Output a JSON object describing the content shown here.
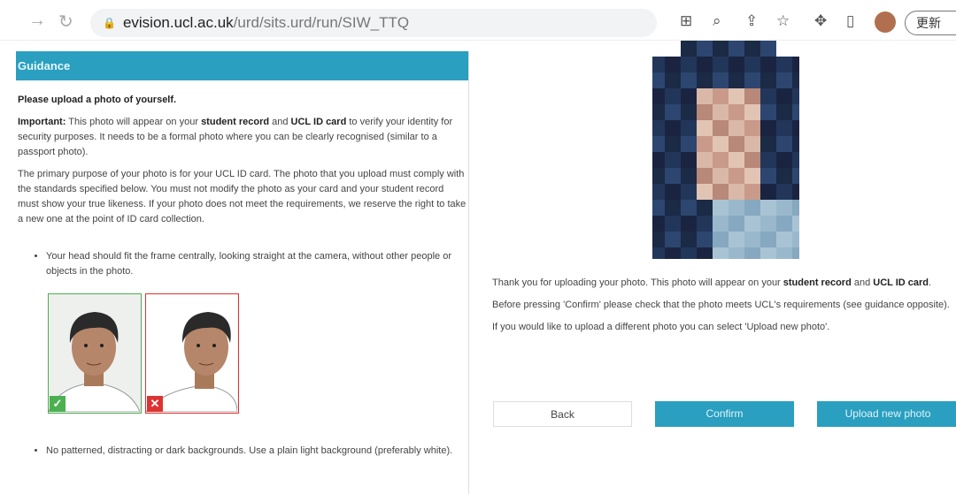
{
  "browser": {
    "url_domain": "evision.ucl.ac.uk",
    "url_path": "/urd/sits.urd/run/SIW_TTQ",
    "update_label": "更新"
  },
  "guidance": {
    "title": "Guidance",
    "intro": "Please upload a photo of yourself.",
    "important_label": "Important:",
    "p1_a": " This photo will appear on your ",
    "p1_b": "student record",
    "p1_c": " and ",
    "p1_d": "UCL ID card",
    "p1_e": " to verify your identity for security purposes. It needs to be a formal photo where you can be clearly recognised (similar to a passport photo).",
    "p2": "The primary purpose of your photo is for your UCL ID card. The photo that you upload must comply with the standards specified below. You must not modify the photo as your card and your student record must show your true likeness. If your photo does not meet the requirements, we reserve the right to take a new one at the point of ID card collection.",
    "bullets": [
      "Your head should fit the frame centrally, looking straight at the camera, without other people or objects in the photo.",
      "No patterned, distracting or dark backgrounds. Use a plain light background (preferably white)."
    ]
  },
  "confirmation": {
    "p1_a": "Thank you for uploading your photo. This photo will appear on your ",
    "p1_b": "student record",
    "p1_c": " and ",
    "p1_d": "UCL ID card",
    "p1_e": ".",
    "p2": "Before pressing 'Confirm' please check that the photo meets UCL's requirements (see guidance opposite).",
    "p3": "If you would like to upload a different photo you can select 'Upload new photo'."
  },
  "buttons": {
    "back": "Back",
    "confirm": "Confirm",
    "upload": "Upload new photo"
  },
  "colors": {
    "accent": "#2a9fc0",
    "good": "#4caf50",
    "bad": "#d33333"
  }
}
